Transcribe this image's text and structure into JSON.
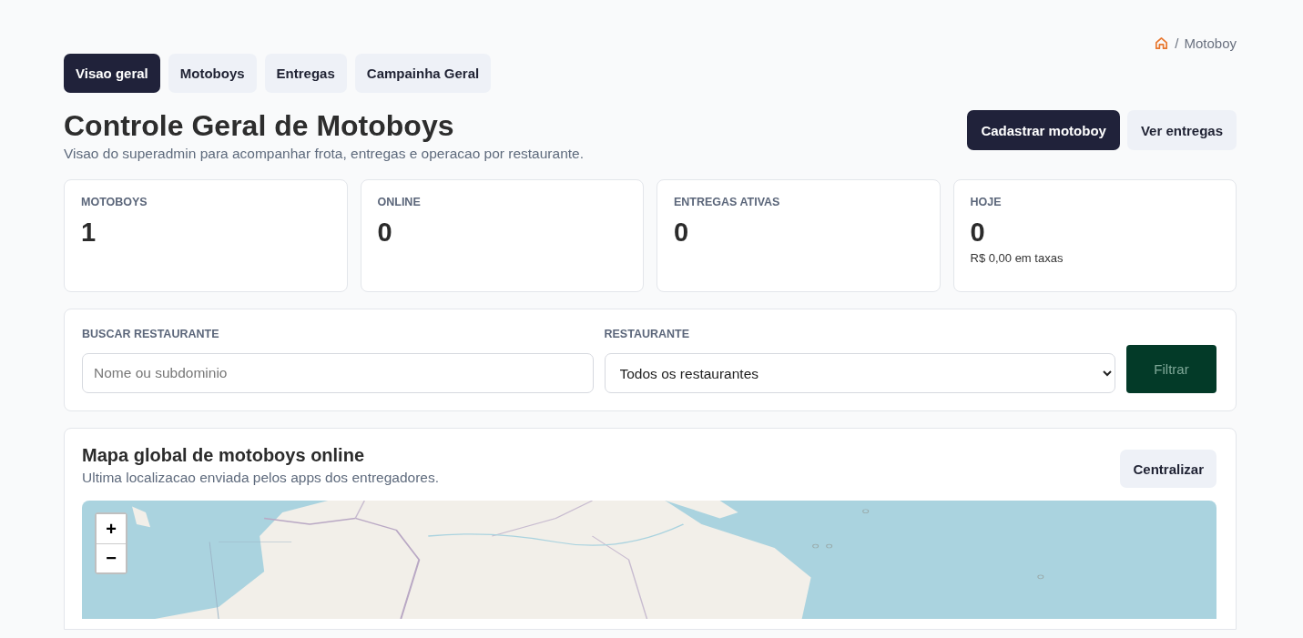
{
  "breadcrumb": {
    "separator": "/",
    "current": "Motoboy"
  },
  "tabs": [
    {
      "label": "Visao geral",
      "selected": true
    },
    {
      "label": "Motoboys",
      "selected": false
    },
    {
      "label": "Entregas",
      "selected": false
    },
    {
      "label": "Campainha Geral",
      "selected": false
    }
  ],
  "header": {
    "title": "Controle Geral de Motoboys",
    "subtitle": "Visao do superadmin para acompanhar frota, entregas e operacao por restaurante.",
    "actions": [
      {
        "label": "Cadastrar motoboy",
        "kind": "primary"
      },
      {
        "label": "Ver entregas",
        "kind": "secondary"
      }
    ]
  },
  "stats": [
    {
      "label": "MOTOBOYS",
      "value": "1"
    },
    {
      "label": "ONLINE",
      "value": "0"
    },
    {
      "label": "ENTREGAS ATIVAS",
      "value": "0"
    },
    {
      "label": "HOJE",
      "value": "0",
      "note": "R$ 0,00 em taxas"
    }
  ],
  "filters": {
    "search": {
      "label": "BUSCAR RESTAURANTE",
      "placeholder": "Nome ou subdominio"
    },
    "restaurant": {
      "label": "RESTAURANTE",
      "value": "Todos os restaurantes"
    },
    "submit": {
      "label": "Filtrar",
      "disabled": true
    }
  },
  "map": {
    "title": "Mapa global de motoboys online",
    "subtitle": "Ultima localizacao enviada pelos apps dos entregadores.",
    "action": "Centralizar",
    "zoom_in": "+",
    "zoom_out": "−"
  }
}
